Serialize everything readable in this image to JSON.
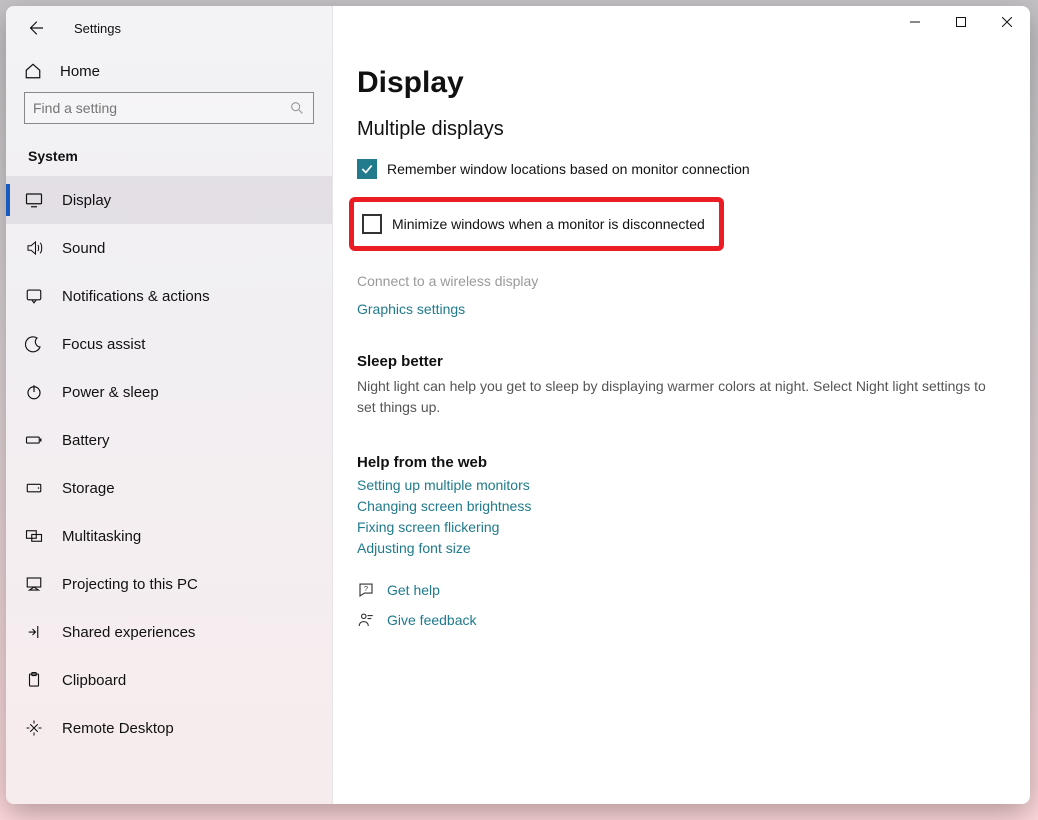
{
  "app_title": "Settings",
  "home_label": "Home",
  "search_placeholder": "Find a setting",
  "category_label": "System",
  "nav_items": [
    "Display",
    "Sound",
    "Notifications & actions",
    "Focus assist",
    "Power & sleep",
    "Battery",
    "Storage",
    "Multitasking",
    "Projecting to this PC",
    "Shared experiences",
    "Clipboard",
    "Remote Desktop"
  ],
  "page_title": "Display",
  "section_title": "Multiple displays",
  "checkbox1_label": "Remember window locations based on monitor connection",
  "checkbox1_checked": true,
  "checkbox2_label": "Minimize windows when a monitor is disconnected",
  "checkbox2_checked": false,
  "wireless_link": "Connect to a wireless display",
  "graphics_link": "Graphics settings",
  "sleep_heading": "Sleep better",
  "sleep_body": "Night light can help you get to sleep by displaying warmer colors at night. Select Night light settings to set things up.",
  "help_heading": "Help from the web",
  "help_links": [
    "Setting up multiple monitors",
    "Changing screen brightness",
    "Fixing screen flickering",
    "Adjusting font size"
  ],
  "get_help_label": "Get help",
  "give_feedback_label": "Give feedback"
}
